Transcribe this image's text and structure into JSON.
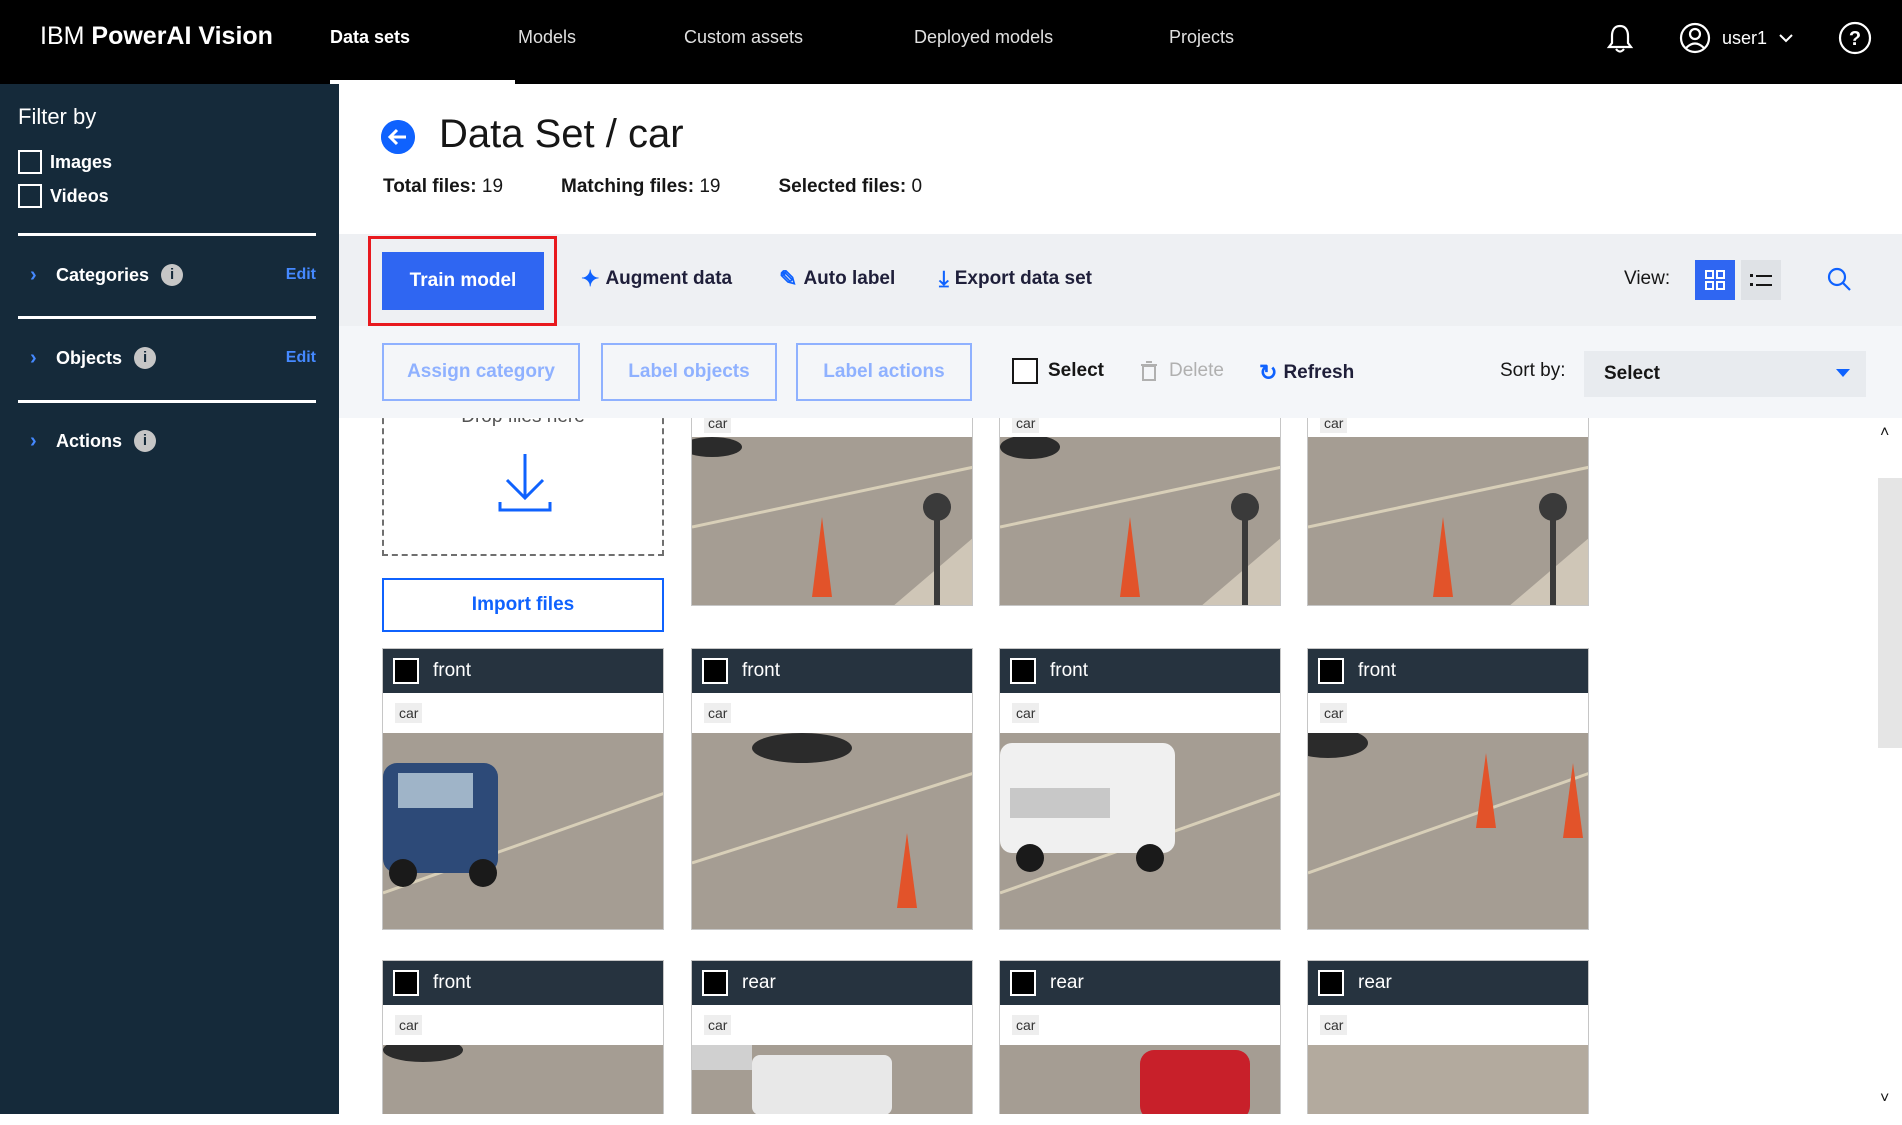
{
  "app": {
    "brand_light": "IBM ",
    "brand_bold": "PowerAI Vision"
  },
  "nav": [
    {
      "label": "Data sets",
      "active": true
    },
    {
      "label": "Models"
    },
    {
      "label": "Custom assets"
    },
    {
      "label": "Deployed models"
    },
    {
      "label": "Projects"
    }
  ],
  "header": {
    "user": "user1"
  },
  "sidebar": {
    "title": "Filter by",
    "filters": [
      "Images",
      "Videos"
    ],
    "sections": [
      {
        "label": "Categories",
        "edit": "Edit"
      },
      {
        "label": "Objects",
        "edit": "Edit"
      },
      {
        "label": "Actions"
      }
    ]
  },
  "page": {
    "title": "Data Set / car",
    "stats": [
      {
        "label": "Total files:",
        "value": "19"
      },
      {
        "label": "Matching files:",
        "value": "19"
      },
      {
        "label": "Selected files:",
        "value": "0"
      }
    ]
  },
  "toolbar": {
    "train": "Train model",
    "augment": "Augment data",
    "autolabel": "Auto label",
    "export": "Export data set",
    "view_label": "View:"
  },
  "actions": {
    "assign": "Assign category",
    "label_objects": "Label objects",
    "label_actions": "Label actions",
    "select": "Select",
    "delete": "Delete",
    "refresh": "Refresh",
    "sort_label": "Sort by:",
    "sort_value": "Select"
  },
  "grid": {
    "drop_text": "Drop files here",
    "import": "Import files",
    "top_row_tags": [
      "car",
      "car",
      "car"
    ],
    "row2": [
      {
        "category": "front",
        "tag": "car"
      },
      {
        "category": "front",
        "tag": "car"
      },
      {
        "category": "front",
        "tag": "car"
      },
      {
        "category": "front",
        "tag": "car"
      }
    ],
    "row3": [
      {
        "category": "front",
        "tag": "car"
      },
      {
        "category": "rear",
        "tag": "car"
      },
      {
        "category": "rear",
        "tag": "car"
      },
      {
        "category": "rear",
        "tag": "car"
      }
    ]
  },
  "colors": {
    "accent": "#0f62fe",
    "highlight": "#e8191e",
    "sidebar": "#152a3a"
  }
}
